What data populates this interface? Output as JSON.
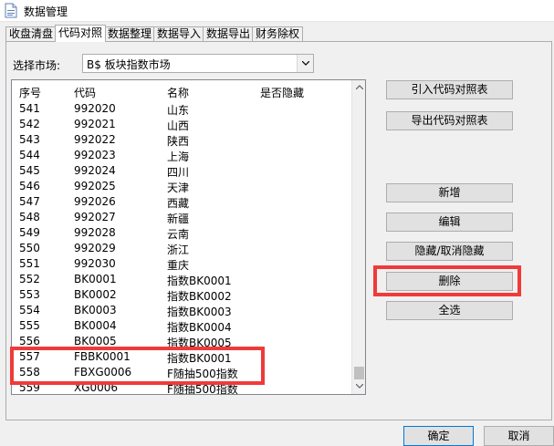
{
  "window": {
    "title": "数据管理",
    "icon": "document-icon"
  },
  "tabs": [
    "收盘清盘",
    "代码对照",
    "数据整理",
    "数据导入",
    "数据导出",
    "财务除权"
  ],
  "active_tab": "代码对照",
  "market": {
    "label": "选择市场:",
    "value": "B$ 板块指数市场"
  },
  "table": {
    "headers": {
      "no": "序号",
      "code": "代码",
      "name": "名称",
      "hidden": "是否隐藏"
    },
    "rows": [
      {
        "no": "541",
        "code": "992020",
        "name": "山东",
        "hidden": ""
      },
      {
        "no": "542",
        "code": "992021",
        "name": "山西",
        "hidden": ""
      },
      {
        "no": "543",
        "code": "992022",
        "name": "陕西",
        "hidden": ""
      },
      {
        "no": "544",
        "code": "992023",
        "name": "上海",
        "hidden": ""
      },
      {
        "no": "545",
        "code": "992024",
        "name": "四川",
        "hidden": ""
      },
      {
        "no": "546",
        "code": "992025",
        "name": "天津",
        "hidden": ""
      },
      {
        "no": "547",
        "code": "992026",
        "name": "西藏",
        "hidden": ""
      },
      {
        "no": "548",
        "code": "992027",
        "name": "新疆",
        "hidden": ""
      },
      {
        "no": "549",
        "code": "992028",
        "name": "云南",
        "hidden": ""
      },
      {
        "no": "550",
        "code": "992029",
        "name": "浙江",
        "hidden": ""
      },
      {
        "no": "551",
        "code": "992030",
        "name": "重庆",
        "hidden": ""
      },
      {
        "no": "552",
        "code": "BK0001",
        "name": "指数BK0001",
        "hidden": ""
      },
      {
        "no": "553",
        "code": "BK0002",
        "name": "指数BK0002",
        "hidden": ""
      },
      {
        "no": "554",
        "code": "BK0003",
        "name": "指数BK0003",
        "hidden": ""
      },
      {
        "no": "555",
        "code": "BK0004",
        "name": "指数BK0004",
        "hidden": ""
      },
      {
        "no": "556",
        "code": "BK0005",
        "name": "指数BK0005",
        "hidden": ""
      },
      {
        "no": "557",
        "code": "FBBK0001",
        "name": "指数BK0001",
        "hidden": ""
      },
      {
        "no": "558",
        "code": "FBXG0006",
        "name": "F随抽500指数",
        "hidden": ""
      },
      {
        "no": "559",
        "code": "XG0006",
        "name": "F随抽500指数",
        "hidden": ""
      }
    ]
  },
  "buttons": {
    "import_map": "引入代码对照表",
    "export_map": "导出代码对照表",
    "add": "新增",
    "edit": "编辑",
    "toggle_hide": "隐藏/取消隐藏",
    "delete": "删除",
    "select_all": "全选",
    "ok": "确定",
    "cancel": "取消"
  },
  "highlight_color": "#f03a3a"
}
